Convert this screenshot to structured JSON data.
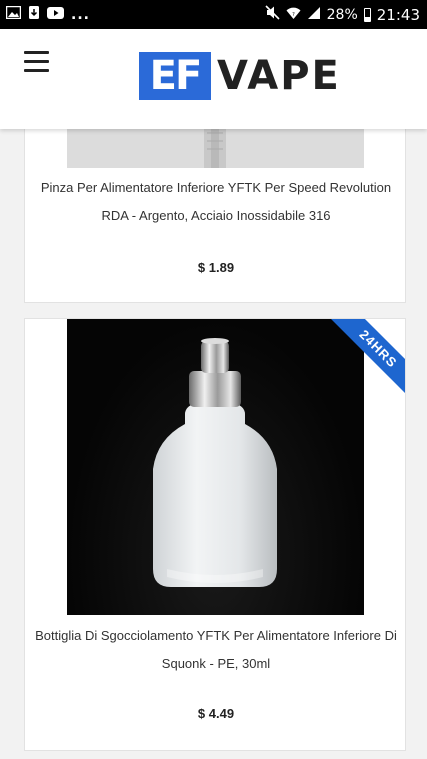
{
  "status_bar": {
    "dots": "...",
    "battery": "28%",
    "time": "21:43"
  },
  "header": {
    "logo_mark": "EF",
    "logo_text": "VAPE"
  },
  "products": [
    {
      "name": "Pinza Per Alimentatore Inferiore YFTK Per Speed Revolution RDA - Argento, Acciaio Inossidabile 316",
      "price": "$ 1.89"
    },
    {
      "name": "Bottiglia Di Sgocciolamento YFTK Per Alimentatore Inferiore Di Squonk - PE, 30ml",
      "price": "$ 4.49",
      "badge": "24HRS"
    }
  ],
  "colors": {
    "brand_blue": "#2b6ad8",
    "badge_blue": "#1e66cf"
  }
}
